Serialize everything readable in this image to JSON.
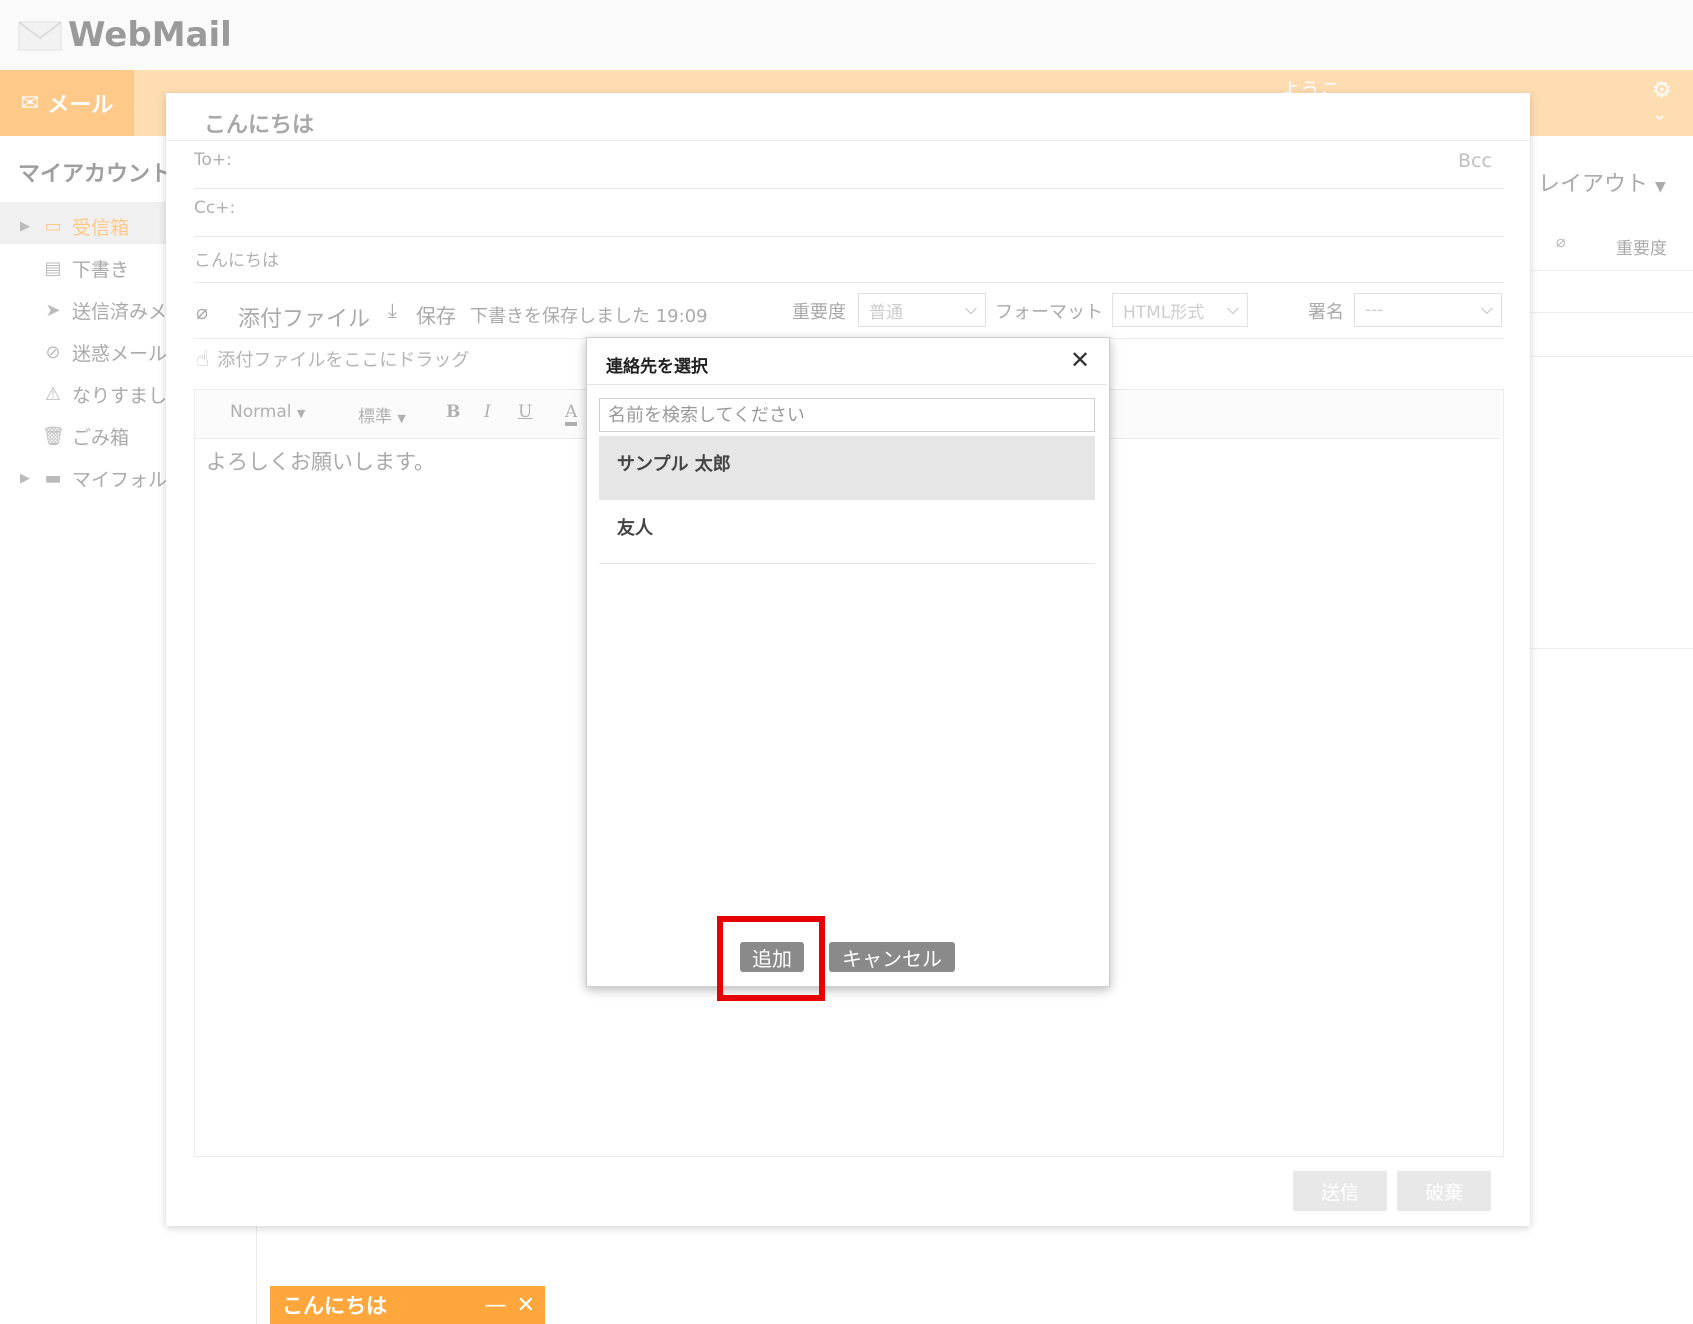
{
  "app": {
    "logo_text": "WebMail",
    "nav_mail_label": "メール",
    "nav_welcome": "ようこ"
  },
  "sidebar": {
    "title": "マイアカウント",
    "items": [
      {
        "label": "受信箱",
        "icon": "inbox-icon"
      },
      {
        "label": "下書き",
        "icon": "draft-icon"
      },
      {
        "label": "送信済みメ",
        "icon": "sent-icon"
      },
      {
        "label": "迷惑メール",
        "icon": "spam-icon"
      },
      {
        "label": "なりすまし",
        "icon": "warning-icon"
      },
      {
        "label": "ごみ箱",
        "icon": "trash-icon"
      },
      {
        "label": "マイフォル",
        "icon": "folder-icon"
      }
    ]
  },
  "list": {
    "layout_label": "レイアウト",
    "col_priority": "重要度"
  },
  "compose": {
    "title": "こんにちは",
    "to_label": "To+:",
    "cc_label": "Cc+:",
    "bcc_label": "Bcc",
    "subject": "こんにちは",
    "attach_label": "添付ファイル",
    "save_label": "保存",
    "draft_status": "下書きを保存しました 19:09",
    "priority_label": "重要度",
    "priority_value": "普通",
    "format_label": "フォーマット",
    "format_value": "HTML形式",
    "signature_label": "署名",
    "signature_value": "---",
    "drag_hint": "添付ファイルをここにドラッグ",
    "toolbar": {
      "style": "Normal",
      "size": "標準",
      "bold": "B",
      "italic": "I",
      "underline": "U",
      "color": "A"
    },
    "body_text": "よろしくお願いします。",
    "send_label": "送信",
    "discard_label": "破棄"
  },
  "minimized": {
    "title": "こんにちは",
    "minimize_glyph": "—",
    "close_glyph": "✕"
  },
  "dialog": {
    "title": "連絡先を選択",
    "close_glyph": "✕",
    "search_placeholder": "名前を検索してください",
    "contacts": [
      {
        "name": "サンプル 太郎",
        "selected": true
      },
      {
        "name": "友人",
        "selected": false
      }
    ],
    "add_label": "追加",
    "cancel_label": "キャンセル"
  },
  "colors": {
    "accent_orange": "#ffa63d",
    "highlight_red": "#e60000",
    "selected_row": "#e6e6e6"
  }
}
